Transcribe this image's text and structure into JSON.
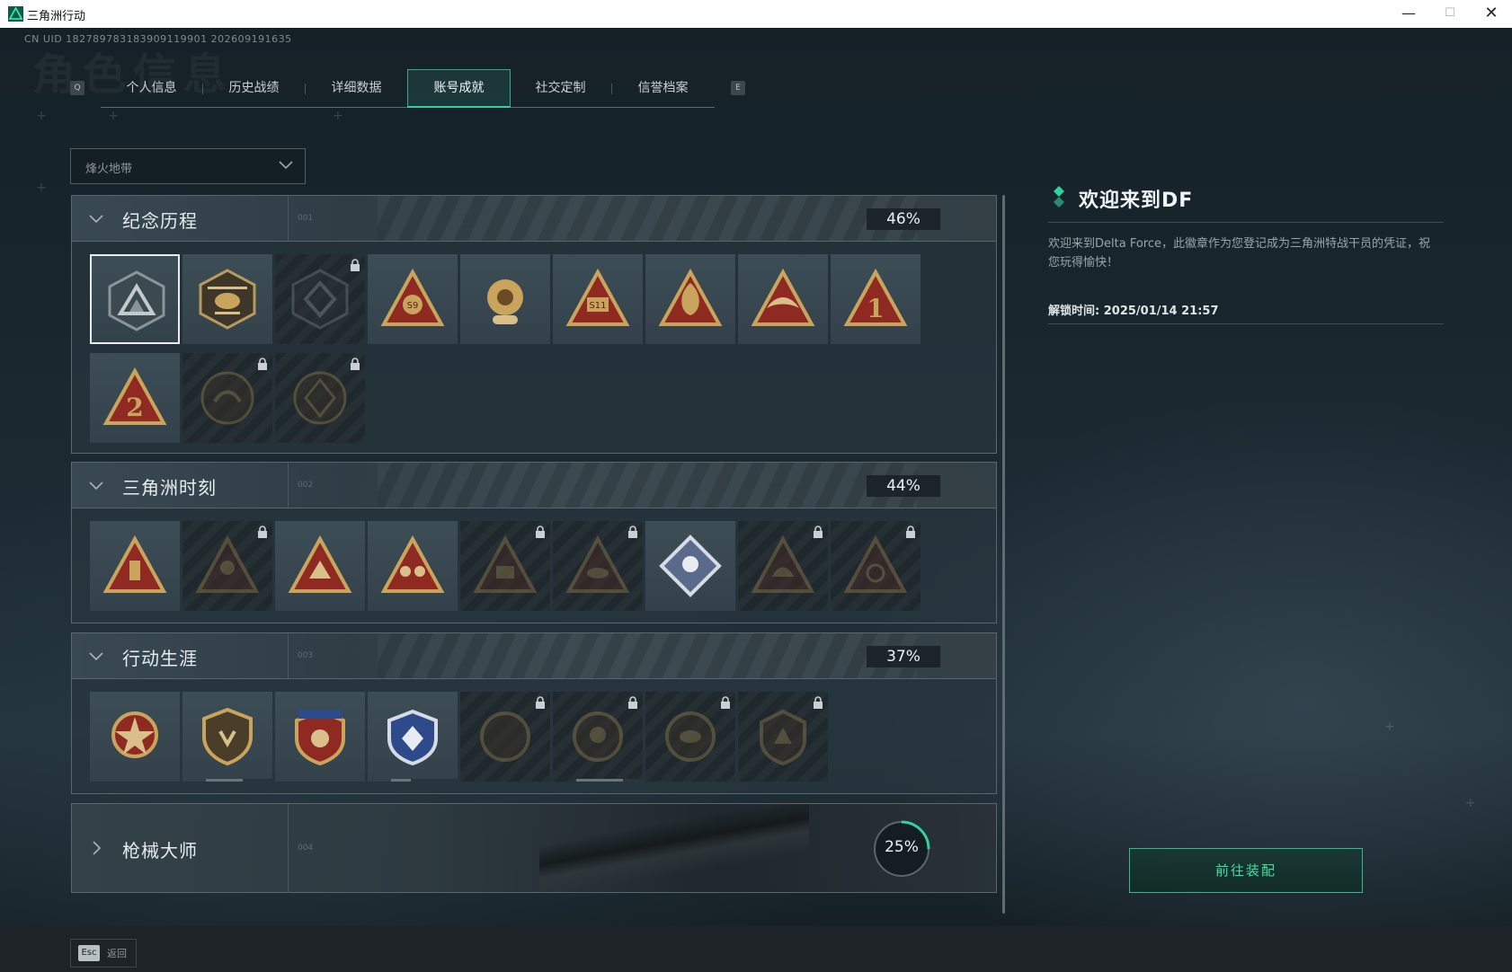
{
  "window": {
    "title": "三角洲行动",
    "minimize": "—",
    "maximize": "☐",
    "close": "✕"
  },
  "page": {
    "uid": "CN UID 18278978318390911990​1 202609191635",
    "watermark": "角色信息"
  },
  "tabs": {
    "left_key": "Q",
    "right_key": "E",
    "items": [
      {
        "label": "个人信息",
        "active": false
      },
      {
        "label": "历史战绩",
        "active": false
      },
      {
        "label": "详细数据",
        "active": false
      },
      {
        "label": "账号成就",
        "active": true
      },
      {
        "label": "社交定制",
        "active": false
      },
      {
        "label": "信誉档案",
        "active": false
      }
    ]
  },
  "filter": {
    "value": "烽火地带"
  },
  "sections": [
    {
      "title": "纪念历程",
      "num": "001",
      "percent": "46%",
      "expanded": true
    },
    {
      "title": "三角洲时刻",
      "num": "002",
      "percent": "44%",
      "expanded": true
    },
    {
      "title": "行动生涯",
      "num": "003",
      "percent": "37%",
      "expanded": true
    },
    {
      "title": "枪械大师",
      "num": "004",
      "percent": "25%",
      "expanded": false,
      "progress": 0.25
    }
  ],
  "detail": {
    "title": "欢迎来到DF",
    "description": "欢迎来到Delta Force，此徽章作为您登记成为三角洲特战干员的凭证，祝您玩得愉快！",
    "unlock_time": "解锁时间: 2025/01/14 21:57",
    "equip_button": "前往装配"
  },
  "footer": {
    "esc_key": "Esc",
    "back_label": "返回"
  },
  "colors": {
    "accent": "#2fd3a0",
    "gold": "#c9a45c",
    "red": "#8e2a22"
  }
}
